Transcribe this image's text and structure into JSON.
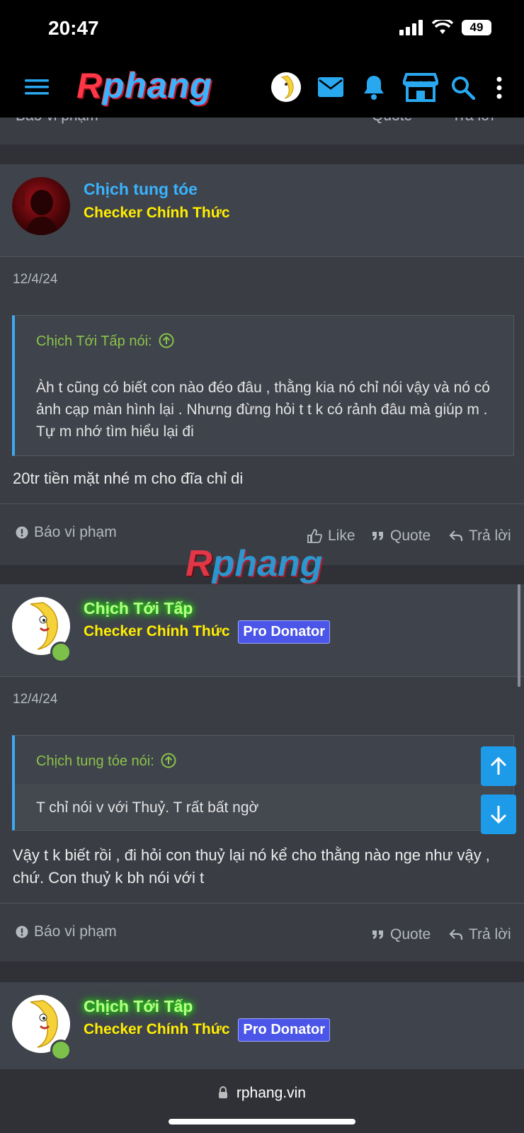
{
  "status_bar": {
    "time": "20:47",
    "battery": "49"
  },
  "nav": {
    "logo_first": "R",
    "logo_rest": "phang"
  },
  "partial_top": {
    "report": "Báo vi phạm",
    "quote": "Quote",
    "reply": "Trả lời"
  },
  "posts": [
    {
      "username": "Chịch tung tóe",
      "user_title": "Checker Chính Thức",
      "date": "12/4/24",
      "quote_author": "Chịch Tới Tấp nói:",
      "quote_body": "Àh t cũng có biết con nào đéo đâu , thằng kia nó chỉ nói vậy và nó có ảnh cạp màn hình lại . Nhưng đừng hỏi t t k có rảnh đâu mà giúp m . Tự m nhớ tìm hiểu lại đi",
      "text": "20tr tiền mặt nhé m cho đĩa chỉ di",
      "report": "Báo vi phạm",
      "like": "Like",
      "quote": "Quote",
      "reply": "Trả lời"
    },
    {
      "username": "Chịch Tới Tấp",
      "user_title": "Checker Chính Thức",
      "badge": "Pro Donator",
      "date": "12/4/24",
      "quote_author": "Chịch tung tóe nói:",
      "quote_body": "T chỉ nói v với Thuỷ. T rất bất ngờ",
      "text": "Vậy t k biết rồi , đi hỏi con thuỷ lại nó kể cho thằng nào nge như vậy , chứ. Con thuỷ k bh nói với t",
      "report": "Báo vi phạm",
      "quote": "Quote",
      "reply": "Trả lời"
    },
    {
      "username": "Chịch Tới Tấp",
      "user_title": "Checker Chính Thức",
      "badge": "Pro Donator"
    }
  ],
  "watermark": {
    "first": "R",
    "rest": "phang"
  },
  "browser": {
    "url": "rphang.vin"
  },
  "colors": {
    "accent": "#1e9be8",
    "username_blue": "#3ab3ff",
    "title_yellow": "#ffee00",
    "quote_green": "#8bc34a",
    "badge": "#4b56e8"
  }
}
